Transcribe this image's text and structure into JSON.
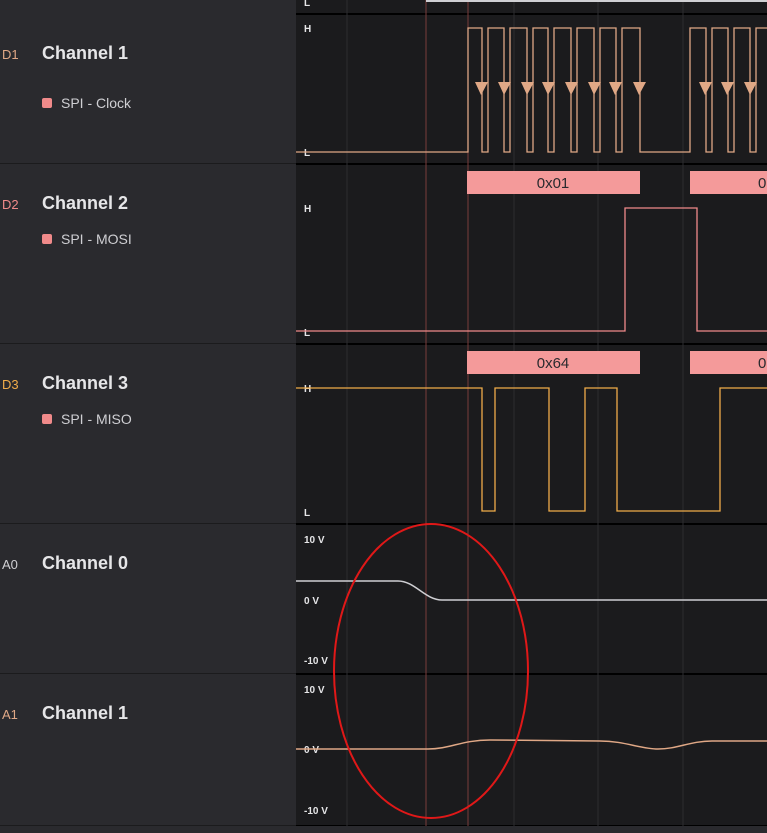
{
  "channels": [
    {
      "id": "D1",
      "name": "Channel 1",
      "analyzer": "SPI - Clock",
      "color": "#e0a886"
    },
    {
      "id": "D2",
      "name": "Channel 2",
      "analyzer": "SPI - MOSI",
      "color": "#f08a8a"
    },
    {
      "id": "D3",
      "name": "Channel 3",
      "analyzer": "SPI - MISO",
      "color": "#f0ac4a"
    },
    {
      "id": "A0",
      "name": "Channel 0",
      "color": "#cfcfd3"
    },
    {
      "id": "A1",
      "name": "Channel 1",
      "color": "#e0a886"
    }
  ],
  "digital_levels": {
    "high": "H",
    "low": "L"
  },
  "analog_scale": {
    "top": "10 V",
    "mid": "0 V",
    "bottom": "-10 V"
  },
  "decodes": {
    "mosi": {
      "first": "0x01",
      "second_partial": "0"
    },
    "miso": {
      "first": "0x64",
      "second_partial": "0"
    }
  },
  "colors": {
    "background": "#1b1b1d",
    "panel": "#2a2a2e",
    "clock": "#e0a886",
    "mosi": "#f08a8a",
    "miso": "#f0ac4a",
    "analog0": "#cfcfd3",
    "decode_box": "#f49a9a",
    "annotation": "#e01818"
  }
}
